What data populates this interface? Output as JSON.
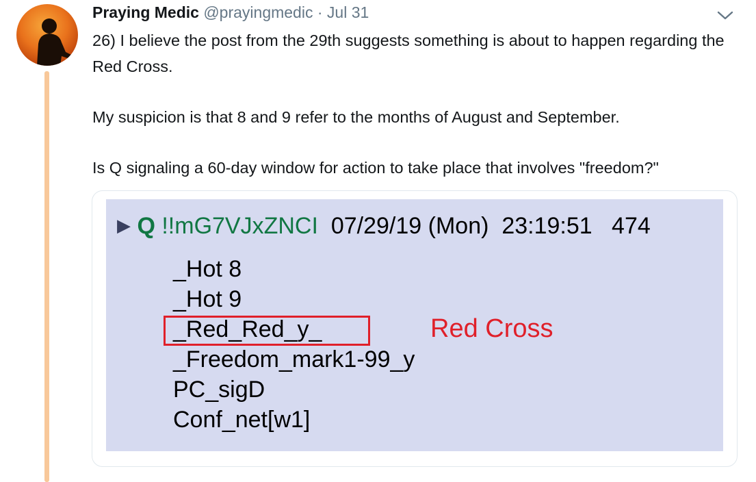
{
  "tweet": {
    "author_name": "Praying Medic",
    "handle": "@prayingmedic",
    "separator": "·",
    "date": "Jul 31",
    "paragraphs": [
      "26) I believe the post from the 29th suggests something is about to happen regarding the Red Cross.",
      "My suspicion is that 8 and 9 refer to the months of August and September.",
      "Is Q signaling a 60-day window for action to take place that involves \"freedom?\""
    ]
  },
  "icons": {
    "avatar": "avatar-silhouette",
    "menu": "chevron-down-icon",
    "post_marker": "triangle-right-icon"
  },
  "image": {
    "arrow": "▶",
    "q_name": "Q",
    "tripcode": "!!mG7VJxZNCI",
    "date": "07/29/19 (Mon)",
    "time": "23:19:51",
    "post_number": "474",
    "lines": [
      "_Hot 8",
      "_Hot 9",
      "_Red_Red_y_",
      "_Freedom_mark1-99_y",
      "PC_sigD",
      "Conf_net[w1]"
    ],
    "annotation": "Red Cross"
  },
  "colors": {
    "thread_line": "#f8c89a",
    "highlight": "#e0202a",
    "q_green": "#117743",
    "image_bg": "#d6daf0"
  }
}
